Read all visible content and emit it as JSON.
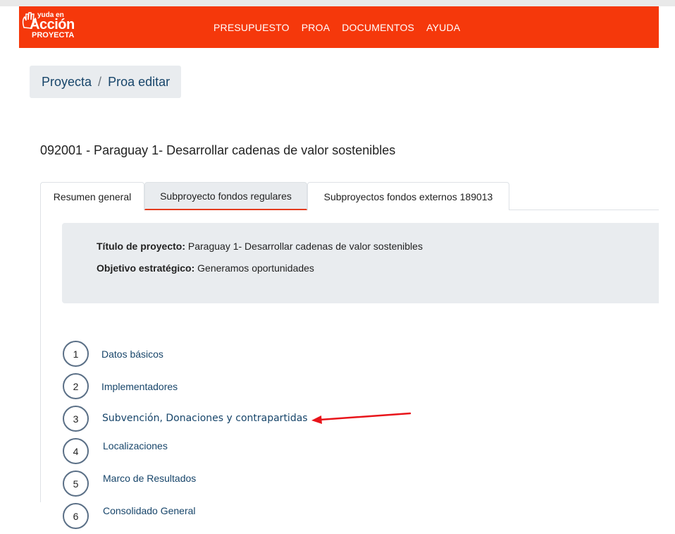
{
  "navbar": {
    "logo": {
      "line1": "yuda en",
      "line2": "Acción",
      "line3": "PROYECTA",
      "icon": "hand-icon"
    },
    "menu": [
      "PRESUPUESTO",
      "PROA",
      "DOCUMENTOS",
      "AYUDA"
    ]
  },
  "breadcrumb": {
    "items": [
      "Proyecta",
      "Proa editar"
    ],
    "separator": "/"
  },
  "project_title": "092001 - Paraguay 1- Desarrollar cadenas de valor sostenibles",
  "tabs": [
    {
      "label": "Resumen general",
      "active": false
    },
    {
      "label": "Subproyecto fondos regulares",
      "active": true
    },
    {
      "label": "Subproyectos fondos externos 189013",
      "active": false
    }
  ],
  "info": {
    "title_label": "Título de proyecto:",
    "title_value": " Paraguay 1- Desarrollar cadenas de valor sostenibles",
    "objective_label": "Objetivo estratégico:",
    "objective_value": " Generamos oportunidades"
  },
  "steps": [
    {
      "number": "1",
      "label": "Datos básicos"
    },
    {
      "number": "2",
      "label": "Implementadores"
    },
    {
      "number": "3",
      "label": "Subvención, Donaciones y contrapartidas"
    },
    {
      "number": "4",
      "label": "Localizaciones"
    },
    {
      "number": "5",
      "label": "Marco de Resultados"
    },
    {
      "number": "6",
      "label": "Consolidado General"
    }
  ],
  "colors": {
    "brand": "#f5380b",
    "link": "#17456a",
    "panel": "#e9ecef",
    "annotation_arrow": "#e8141a"
  },
  "annotation": {
    "icon": "red-arrow-icon"
  }
}
